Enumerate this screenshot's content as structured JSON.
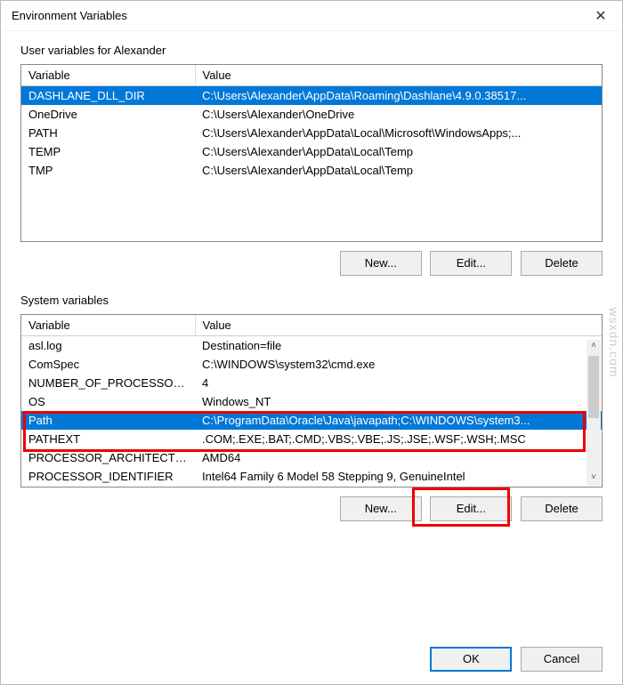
{
  "titlebar": {
    "text": "Environment Variables",
    "close_icon": "✕"
  },
  "user_section": {
    "label": "User variables for Alexander",
    "columns": {
      "variable": "Variable",
      "value": "Value"
    },
    "rows": [
      {
        "variable": "DASHLANE_DLL_DIR",
        "value": "C:\\Users\\Alexander\\AppData\\Roaming\\Dashlane\\4.9.0.38517...",
        "selected": true
      },
      {
        "variable": "OneDrive",
        "value": "C:\\Users\\Alexander\\OneDrive",
        "selected": false
      },
      {
        "variable": "PATH",
        "value": "C:\\Users\\Alexander\\AppData\\Local\\Microsoft\\WindowsApps;...",
        "selected": false
      },
      {
        "variable": "TEMP",
        "value": "C:\\Users\\Alexander\\AppData\\Local\\Temp",
        "selected": false
      },
      {
        "variable": "TMP",
        "value": "C:\\Users\\Alexander\\AppData\\Local\\Temp",
        "selected": false
      }
    ],
    "buttons": {
      "new": "New...",
      "edit": "Edit...",
      "delete": "Delete"
    }
  },
  "system_section": {
    "label": "System variables",
    "columns": {
      "variable": "Variable",
      "value": "Value"
    },
    "rows": [
      {
        "variable": "asl.log",
        "value": "Destination=file",
        "selected": false
      },
      {
        "variable": "ComSpec",
        "value": "C:\\WINDOWS\\system32\\cmd.exe",
        "selected": false
      },
      {
        "variable": "NUMBER_OF_PROCESSORS",
        "value": "4",
        "selected": false
      },
      {
        "variable": "OS",
        "value": "Windows_NT",
        "selected": false
      },
      {
        "variable": "Path",
        "value": "C:\\ProgramData\\Oracle\\Java\\javapath;C:\\WINDOWS\\system3...",
        "selected": true
      },
      {
        "variable": "PATHEXT",
        "value": ".COM;.EXE;.BAT;.CMD;.VBS;.VBE;.JS;.JSE;.WSF;.WSH;.MSC",
        "selected": false
      },
      {
        "variable": "PROCESSOR_ARCHITECTU...",
        "value": "AMD64",
        "selected": false
      },
      {
        "variable": "PROCESSOR_IDENTIFIER",
        "value": "Intel64 Family 6 Model 58 Stepping 9, GenuineIntel",
        "selected": false
      }
    ],
    "buttons": {
      "new": "New...",
      "edit": "Edit...",
      "delete": "Delete"
    }
  },
  "dialog_buttons": {
    "ok": "OK",
    "cancel": "Cancel"
  },
  "scroll": {
    "up": "˄",
    "down": "˅"
  },
  "watermark": "wsxdn.com"
}
